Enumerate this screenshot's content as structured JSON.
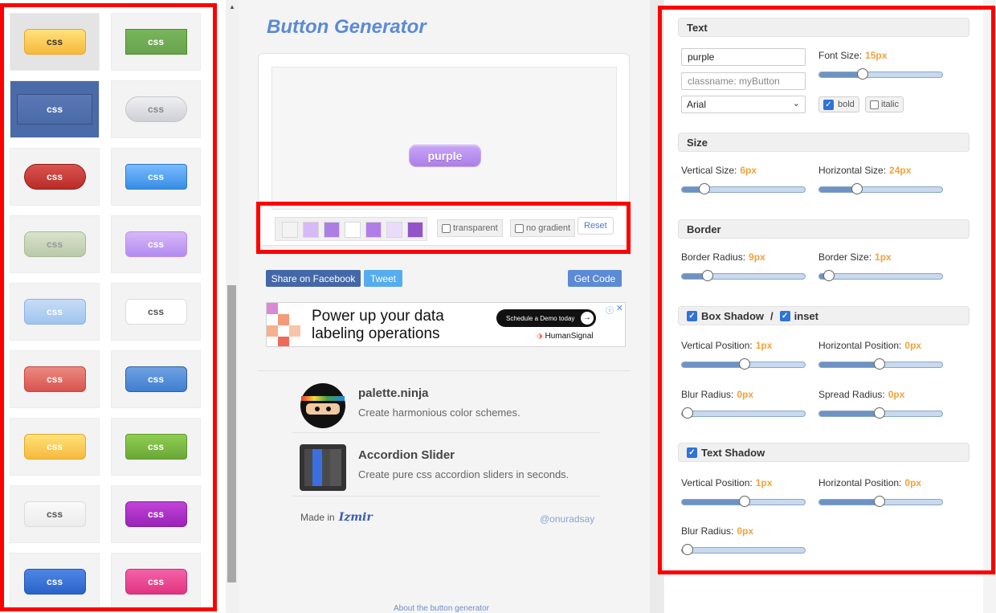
{
  "gallery": {
    "styles": [
      {
        "label": "css",
        "bg": "linear-gradient(#ffe27a,#f6b93b)",
        "color": "#333",
        "border": "#e6a82b",
        "radius": 6
      },
      {
        "label": "css",
        "bg": "linear-gradient(#77b55a,#6aa34f)",
        "color": "#fff",
        "border": "#4b8f29",
        "radius": 0
      },
      {
        "label": "css",
        "bg": "linear-gradient(#5b78b5,#4a6aa8)",
        "color": "#fff",
        "border": "#3a5284",
        "radius": 0
      },
      {
        "label": "css",
        "bg": "linear-gradient(#f0f0f2,#cfd0d6)",
        "color": "#888",
        "border": "#c6c7cc",
        "radius": 16
      },
      {
        "label": "css",
        "bg": "linear-gradient(#d9534f,#b92c28)",
        "color": "#fff",
        "border": "#8f1e1b",
        "radius": 16
      },
      {
        "label": "css",
        "bg": "linear-gradient(#79bbff,#378de5)",
        "color": "#fff",
        "border": "#337bc4",
        "radius": 4
      },
      {
        "label": "css",
        "bg": "linear-gradient(#d8e3cc,#b9c9a9)",
        "color": "#999",
        "border": "#a9b89a",
        "radius": 8
      },
      {
        "label": "css",
        "bg": "linear-gradient(#d6b8f7,#b38cf0)",
        "color": "#fff",
        "border": "#b892ef",
        "radius": 6
      },
      {
        "label": "css",
        "bg": "linear-gradient(#c7dcf7,#9fc4ee)",
        "color": "#fff",
        "border": "#8cb2e4",
        "radius": 6
      },
      {
        "label": "css",
        "bg": "#fff",
        "color": "#555",
        "border": "#dcdcdc",
        "radius": 6
      },
      {
        "label": "css",
        "bg": "linear-gradient(#ec8a80,#d9534f)",
        "color": "#fff",
        "border": "#c9463f",
        "radius": 6
      },
      {
        "label": "css",
        "bg": "linear-gradient(#6fa1e2,#3f7fd0)",
        "color": "#fff",
        "border": "#2e5ea8",
        "radius": 6
      },
      {
        "label": "css",
        "bg": "linear-gradient(#ffe27a,#f6b93b)",
        "color": "#fff",
        "border": "#e6a82b",
        "radius": 6
      },
      {
        "label": "css",
        "bg": "linear-gradient(#8fce52,#6aa837)",
        "color": "#fff",
        "border": "#5e9a2e",
        "radius": 4
      },
      {
        "label": "css",
        "bg": "linear-gradient(#fafafa,#ececec)",
        "color": "#555",
        "border": "#dcdcdc",
        "radius": 6
      },
      {
        "label": "css",
        "bg": "linear-gradient(#c044d8,#9a23b8)",
        "color": "#fff",
        "border": "#8a1ea6",
        "radius": 6
      },
      {
        "label": "css",
        "bg": "linear-gradient(#4f86e6,#2a63c9)",
        "color": "#fff",
        "border": "#2456b0",
        "radius": 6
      },
      {
        "label": "css",
        "bg": "linear-gradient(#f462a8,#e1347f)",
        "color": "#fff",
        "border": "#cc2b72",
        "radius": 6
      }
    ]
  },
  "title": "Button Generator",
  "preview": {
    "button_text": "purple",
    "swatches": [
      "#f3f3f3",
      "#d6b9f5",
      "#ad7de6",
      "#ffffff",
      "#b07ee8",
      "#e9dcfa",
      "#9353c9"
    ],
    "transparent_label": "transparent",
    "no_gradient_label": "no gradient",
    "reset_label": "Reset"
  },
  "share": {
    "facebook": "Share on Facebook",
    "tweet": "Tweet",
    "get_code": "Get Code"
  },
  "ad": {
    "headline": "Power up your data labeling operations",
    "cta": "Schedule a Demo today",
    "brand": "HumanSignal",
    "info": "ⓘ",
    "close": "✕"
  },
  "promos": [
    {
      "title": "palette.ninja",
      "desc": "Create harmonious color schemes."
    },
    {
      "title": "Accordion Slider",
      "desc": "Create pure css accordion sliders in seconds."
    }
  ],
  "footer": {
    "made_in": "Made in",
    "made_in_logo": "Izmir",
    "author": "@onuradsay",
    "about": "About the button generator"
  },
  "settings": {
    "text": {
      "header": "Text",
      "value": "purple",
      "classname_placeholder": "classname: myButton",
      "font": "Arial",
      "font_size_label": "Font Size:",
      "font_size_value": "15px",
      "font_size_level": 0.35,
      "bold_label": "bold",
      "bold_checked": true,
      "italic_label": "italic",
      "italic_checked": false
    },
    "size": {
      "header": "Size",
      "vertical_label": "Vertical Size:",
      "vertical_value": "6px",
      "vertical_level": 0.18,
      "horizontal_label": "Horizontal Size:",
      "horizontal_value": "24px",
      "horizontal_level": 0.31
    },
    "border": {
      "header": "Border",
      "radius_label": "Border Radius:",
      "radius_value": "9px",
      "radius_level": 0.21,
      "size_label": "Border Size:",
      "size_value": "1px",
      "size_level": 0.08
    },
    "box_shadow": {
      "header": "Box Shadow",
      "slash": "/",
      "inset_label": "inset",
      "vpos_label": "Vertical Position:",
      "vpos_value": "1px",
      "vpos_level": 0.51,
      "hpos_label": "Horizontal Position:",
      "hpos_value": "0px",
      "hpos_level": 0.49,
      "blur_label": "Blur Radius:",
      "blur_value": "0px",
      "blur_level": 0.0,
      "spread_label": "Spread Radius:",
      "spread_value": "0px",
      "spread_level": 0.49
    },
    "text_shadow": {
      "header": "Text Shadow",
      "vpos_label": "Vertical Position:",
      "vpos_value": "1px",
      "vpos_level": 0.51,
      "hpos_label": "Horizontal Position:",
      "hpos_value": "0px",
      "hpos_level": 0.49,
      "blur_label": "Blur Radius:",
      "blur_value": "0px",
      "blur_level": 0.0
    }
  },
  "colors": {
    "accent": "#5b8ad6",
    "value_orange": "#f2a23a",
    "highlight_frame": "#ff0000"
  }
}
